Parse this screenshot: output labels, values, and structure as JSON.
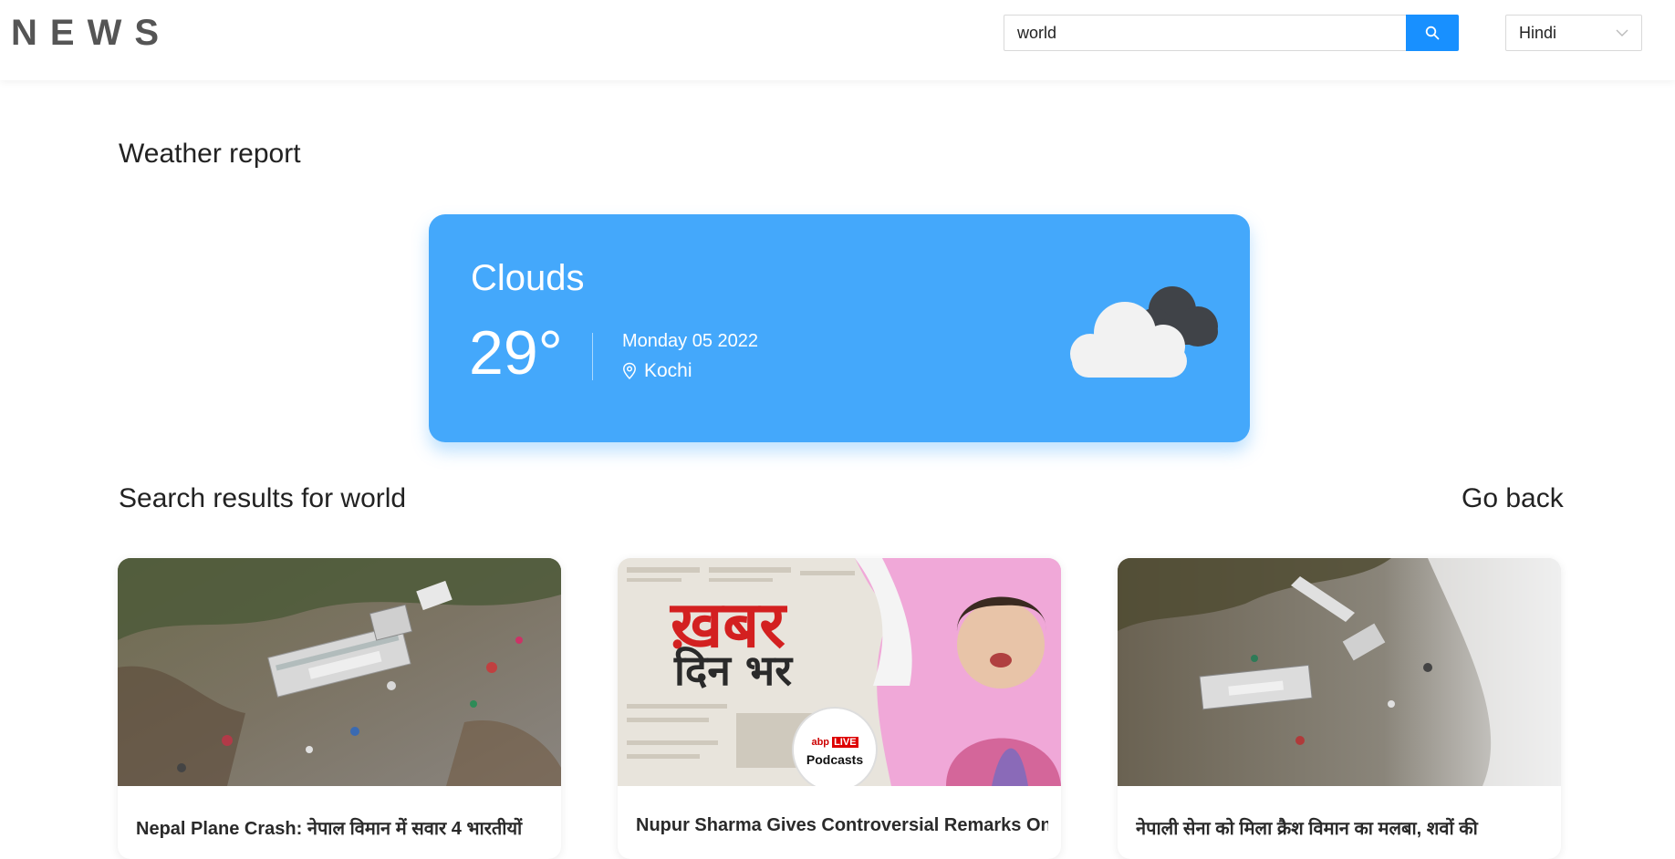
{
  "header": {
    "brand": "NEWS",
    "search": {
      "value": "world",
      "icon": "search-icon"
    },
    "language": {
      "selected": "Hindi",
      "icon": "chevron-down-icon"
    }
  },
  "weather": {
    "section_title": "Weather report",
    "condition": "Clouds",
    "temperature": "29°",
    "date": "Monday 05 2022",
    "location": "Kochi",
    "location_icon": "map-pin-icon",
    "condition_icon": "cloud-icon",
    "card_color": "#44a8fb"
  },
  "results": {
    "title": "Search results for world",
    "go_back_label": "Go back",
    "articles": [
      {
        "title": "Nepal Plane Crash: नेपाल विमान में सवार 4 भारतीयों",
        "image": "plane-crash-wreckage-image"
      },
      {
        "title": "Nupur Sharma Gives Controversial Remarks On",
        "image": "khabar-din-bhar-podcast-image",
        "image_text": {
          "khabar": "ख़बर",
          "din_bhar": "दिन भर",
          "brand": "abp",
          "live": "LIVE",
          "podcasts": "Podcasts"
        }
      },
      {
        "title": "नेपाली सेना को मिला क्रैश विमान का मलबा, शवों की",
        "image": "crash-site-debris-image"
      }
    ]
  },
  "colors": {
    "accent": "#1890ff",
    "weather_bg": "#44a8fb"
  }
}
